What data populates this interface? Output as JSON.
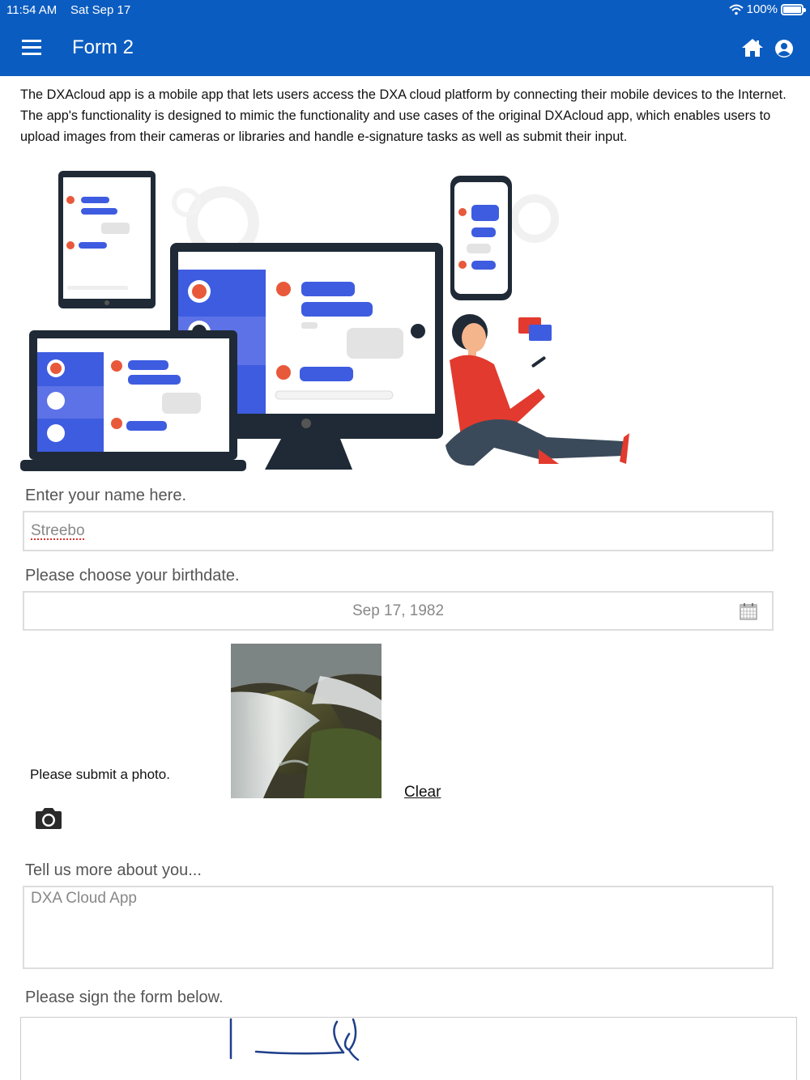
{
  "status_bar": {
    "time": "11:54 AM",
    "date": "Sat Sep 17",
    "battery": "100%"
  },
  "app_bar": {
    "title": "Form 2",
    "menu_icon": "hamburger-menu-icon",
    "home_icon": "home-icon",
    "account_icon": "account-circle-icon",
    "color": "#0b5cc0"
  },
  "description": "The DXAcloud app is a mobile app that lets users access the DXA cloud platform by connecting their mobile devices to the Internet. The app's functionality is designed to mimic the functionality and use cases of the original DXAcloud app, which enables users to upload images from their cameras or libraries and handle e-signature tasks as well as submit their input.",
  "form": {
    "name": {
      "label": "Enter your name here.",
      "value": "Streebo"
    },
    "birthdate": {
      "label": "Please choose your birthdate.",
      "value": "Sep 17, 1982",
      "icon": "calendar-icon"
    },
    "photo": {
      "label": "Please submit a photo.",
      "clear_label": "Clear",
      "camera_icon": "camera-icon"
    },
    "about": {
      "label": "Tell us more about you...",
      "value": "DXA Cloud App"
    },
    "signature": {
      "label": "Please sign the form below."
    }
  }
}
